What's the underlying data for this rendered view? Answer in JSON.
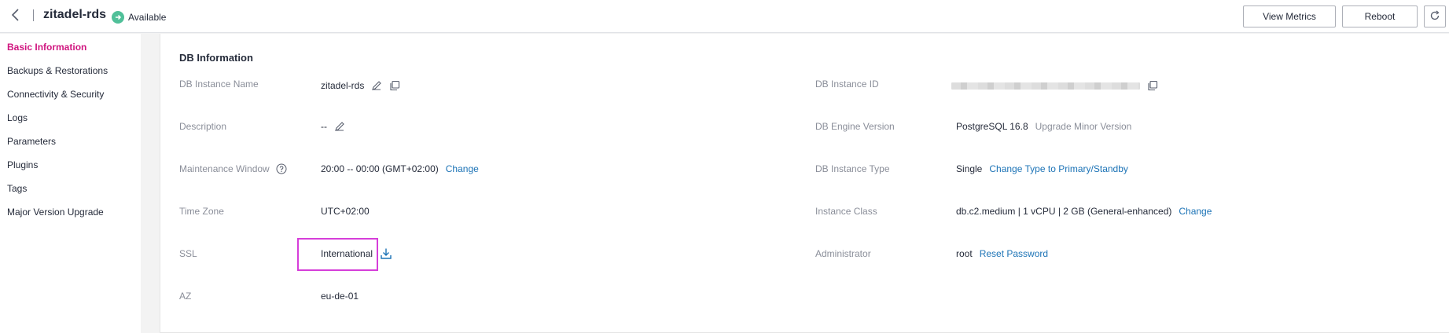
{
  "header": {
    "title": "zitadel-rds",
    "status": "Available",
    "view_metrics": "View Metrics",
    "reboot": "Reboot"
  },
  "sidebar": {
    "items": [
      {
        "label": "Basic Information"
      },
      {
        "label": "Backups & Restorations"
      },
      {
        "label": "Connectivity & Security"
      },
      {
        "label": "Logs"
      },
      {
        "label": "Parameters"
      },
      {
        "label": "Plugins"
      },
      {
        "label": "Tags"
      },
      {
        "label": "Major Version Upgrade"
      }
    ]
  },
  "db_info": {
    "title": "DB Information",
    "instance_name_label": "DB Instance Name",
    "instance_name": "zitadel-rds",
    "description_label": "Description",
    "description": "--",
    "maintenance_label": "Maintenance Window",
    "maintenance": "20:00 -- 00:00 (GMT+02:00)",
    "maintenance_change": "Change",
    "timezone_label": "Time Zone",
    "timezone": "UTC+02:00",
    "ssl_label": "SSL",
    "ssl": "International",
    "az_label": "AZ",
    "az": "eu-de-01",
    "instance_id_label": "DB Instance ID",
    "engine_label": "DB Engine Version",
    "engine": "PostgreSQL 16.8",
    "engine_upgrade": "Upgrade Minor Version",
    "type_label": "DB Instance Type",
    "type": "Single",
    "type_change": "Change Type to Primary/Standby",
    "class_label": "Instance Class",
    "class": "db.c2.medium | 1 vCPU | 2 GB (General-enhanced)",
    "class_change": "Change",
    "admin_label": "Administrator",
    "admin": "root",
    "admin_reset": "Reset Password"
  },
  "colors": {
    "accent": "#d0157f",
    "link": "#1c73b6",
    "status": "#50c099",
    "highlight": "#d63ed9"
  }
}
